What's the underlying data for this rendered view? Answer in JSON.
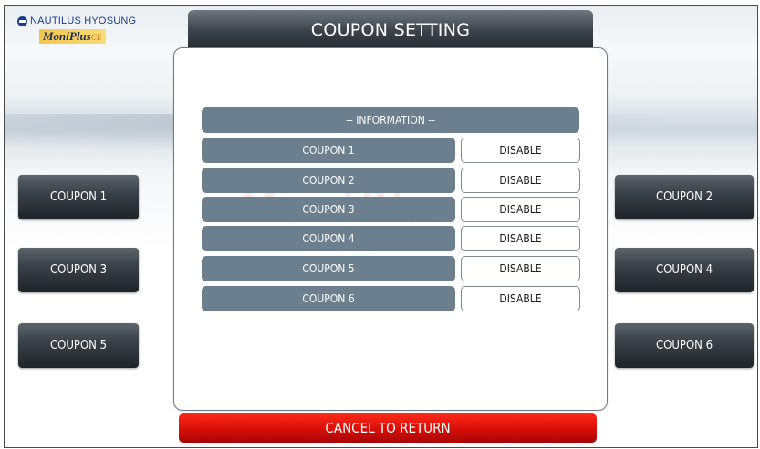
{
  "brand": {
    "company": "NAUTILUS HYOSUNG",
    "product": "MoniPlus",
    "product_suffix": "CE"
  },
  "header": {
    "title": "COUPON SETTING"
  },
  "info": {
    "label": "-- INFORMATION --"
  },
  "rows": [
    {
      "label": "COUPON 1",
      "value": "DISABLE"
    },
    {
      "label": "COUPON 2",
      "value": "DISABLE"
    },
    {
      "label": "COUPON 3",
      "value": "DISABLE"
    },
    {
      "label": "COUPON 4",
      "value": "DISABLE"
    },
    {
      "label": "COUPON 5",
      "value": "DISABLE"
    },
    {
      "label": "COUPON 6",
      "value": "DISABLE"
    }
  ],
  "left_buttons": [
    "COUPON 1",
    "COUPON 3",
    "COUPON 5"
  ],
  "right_buttons": [
    "COUPON 2",
    "COUPON 4",
    "COUPON 6"
  ],
  "footer": {
    "cancel_label": "CANCEL TO RETURN"
  },
  "colors": {
    "title_bar": "#3d444c",
    "row_fill": "#6b7f8e",
    "cancel": "#d40f08"
  }
}
